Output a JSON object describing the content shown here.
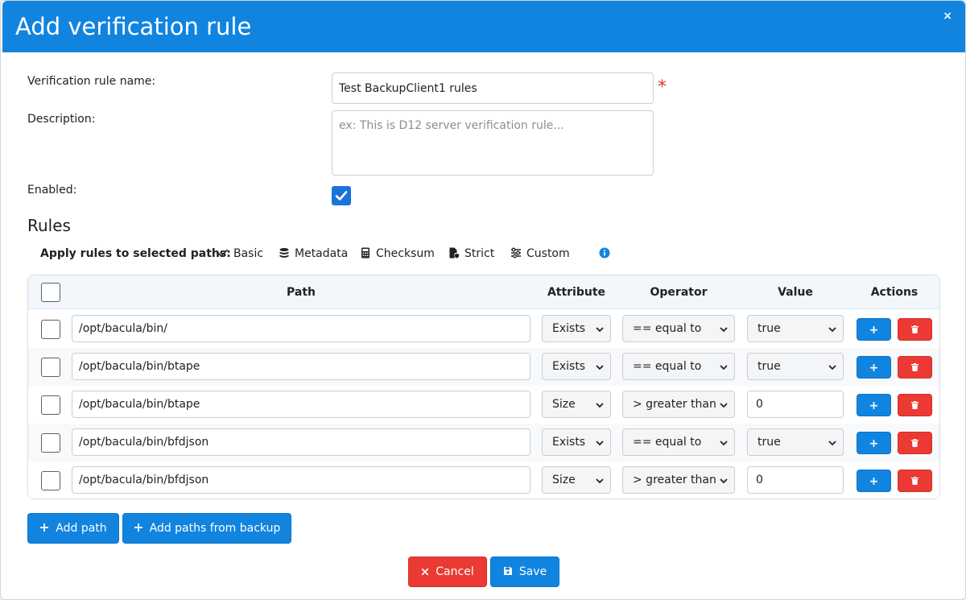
{
  "header": {
    "title": "Add verification rule",
    "close": "×"
  },
  "form": {
    "name_label": "Verification rule name:",
    "name_value": "Test BackupClient1 rules",
    "required_mark": "*",
    "description_label": "Description:",
    "description_placeholder": "ex: This is D12 server verification rule...",
    "enabled_label": "Enabled:",
    "enabled": true
  },
  "rules": {
    "title": "Rules",
    "apply_label": "Apply rules to selected paths:",
    "apply_options": [
      "Basic",
      "Metadata",
      "Checksum",
      "Strict",
      "Custom"
    ],
    "columns": [
      "Path",
      "Attribute",
      "Operator",
      "Value",
      "Actions"
    ],
    "rows": [
      {
        "path": "/opt/bacula/bin/",
        "attribute": "Exists",
        "operator": "== equal to",
        "value": "true",
        "value_type": "select"
      },
      {
        "path": "/opt/bacula/bin/btape",
        "attribute": "Exists",
        "operator": "== equal to",
        "value": "true",
        "value_type": "select"
      },
      {
        "path": "/opt/bacula/bin/btape",
        "attribute": "Size",
        "operator": "> greater than",
        "value": "0",
        "value_type": "input"
      },
      {
        "path": "/opt/bacula/bin/bfdjson",
        "attribute": "Exists",
        "operator": "== equal to",
        "value": "true",
        "value_type": "select"
      },
      {
        "path": "/opt/bacula/bin/bfdjson",
        "attribute": "Size",
        "operator": "> greater than",
        "value": "0",
        "value_type": "input"
      }
    ],
    "add_row_symbol": "+"
  },
  "buttons": {
    "add_path": "Add path",
    "add_paths_from_backup": "Add paths from backup",
    "cancel": "Cancel",
    "save": "Save"
  },
  "colors": {
    "primary": "#1184e0",
    "danger": "#ea3a33",
    "checkbox": "#1a73d9"
  }
}
